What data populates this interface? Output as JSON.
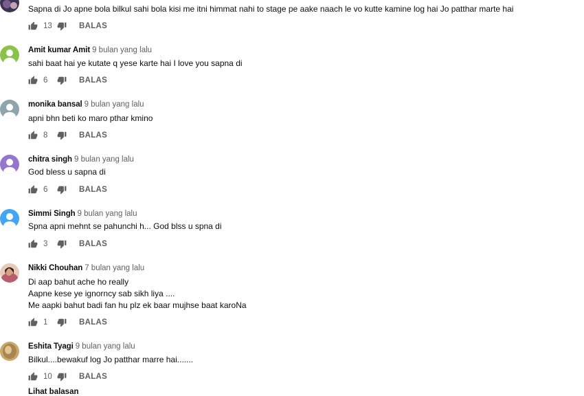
{
  "reply_label": "BALAS",
  "more_replies": "Lihat balasan",
  "colors": {
    "avatar_green": "#8bc34a",
    "avatar_gray": "#90a4ae",
    "avatar_purple": "#9575cd",
    "avatar_blue": "#42a5f5"
  },
  "comments": [
    {
      "author": "",
      "time": "",
      "lines": [
        "Sapna di Jo apne bola bilkul sahi bola kisi me itni himmat nahi to stage pe aake naach le vo kutte kamine log hai Jo patthar marte hai"
      ],
      "likes": "13",
      "avatar": "photo-dark"
    },
    {
      "author": "Amit kumar Amit",
      "time": "9 bulan yang lalu",
      "lines": [
        "sahi baat hai ye kutate q yese karte hai  I love you sapna di"
      ],
      "likes": "6",
      "avatar": "default-green"
    },
    {
      "author": "monika bansal",
      "time": "9 bulan yang lalu",
      "lines": [
        "apni bhn beti ko maro pthar kmino"
      ],
      "likes": "8",
      "avatar": "default-gray"
    },
    {
      "author": "chitra singh",
      "time": "9 bulan yang lalu",
      "lines": [
        "God bless u sapna di"
      ],
      "likes": "6",
      "avatar": "default-purple"
    },
    {
      "author": "Simmi Singh",
      "time": "9 bulan yang lalu",
      "lines": [
        "Spna apni mehnt se pahunchi h... God blss u spna di"
      ],
      "likes": "3",
      "avatar": "default-blue"
    },
    {
      "author": "Nikki Chouhan",
      "time": "7 bulan yang lalu",
      "lines": [
        "Di aap bahut ache ho really",
        "Aapne kese ye ignorncy sab sikh liya ....",
        "Me aapki bahut badi fan hu plz ek baar mujhse baat karoNa"
      ],
      "likes": "1",
      "avatar": "photo-woman"
    },
    {
      "author": "Eshita Tyagi",
      "time": "9 bulan yang lalu",
      "lines": [
        "Bilkul....bewakuf log Jo patthar marre hai......."
      ],
      "likes": "10",
      "avatar": "photo-tan"
    }
  ]
}
